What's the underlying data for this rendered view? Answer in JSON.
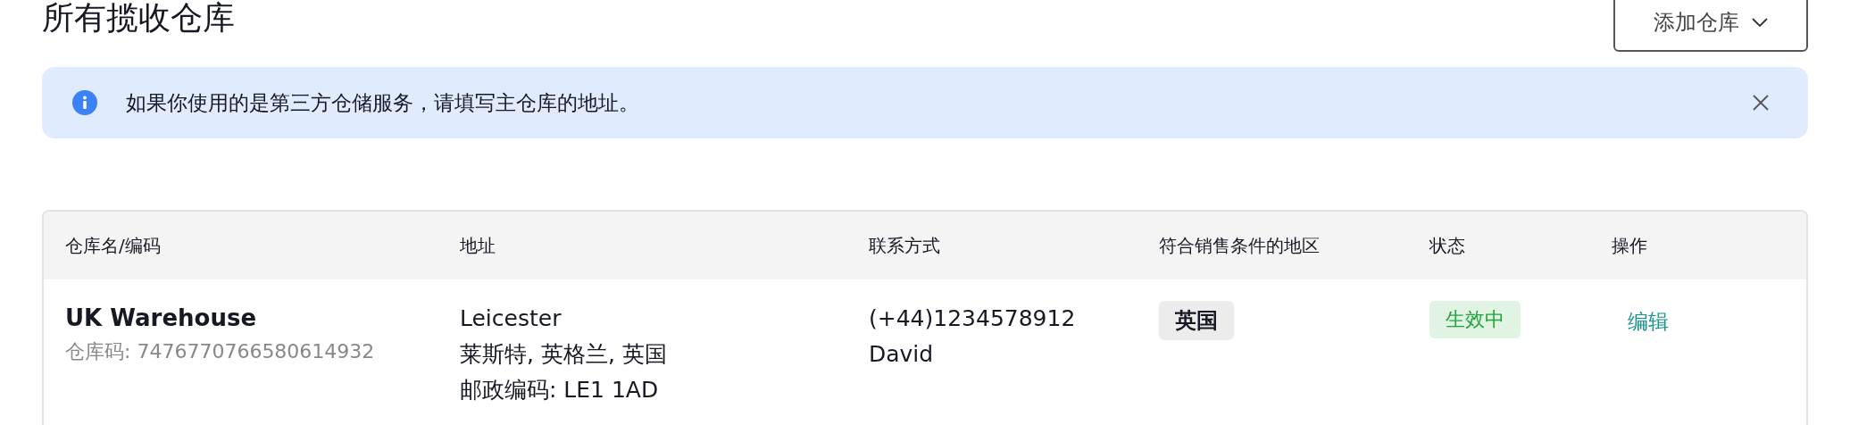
{
  "page": {
    "title": "所有揽收仓库",
    "add_button": "添加仓库"
  },
  "notice": {
    "text": "如果你使用的是第三方仓储服务，请填写主仓库的地址。",
    "dismissible": true
  },
  "table": {
    "columns": [
      "仓库名/编码",
      "地址",
      "联系方式",
      "符合销售条件的地区",
      "状态",
      "操作"
    ],
    "rows": [
      {
        "name": "UK Warehouse",
        "code": "仓库码: 7476770766580614932",
        "address": [
          "Leicester",
          "莱斯特, 英格兰, 英国",
          "邮政编码: LE1 1AD"
        ],
        "contact": [
          "(+44)1234578912",
          "David"
        ],
        "regions": [
          "英国"
        ],
        "status": {
          "label": "生效中",
          "kind": "active"
        },
        "actions": [
          "编辑"
        ]
      }
    ]
  }
}
